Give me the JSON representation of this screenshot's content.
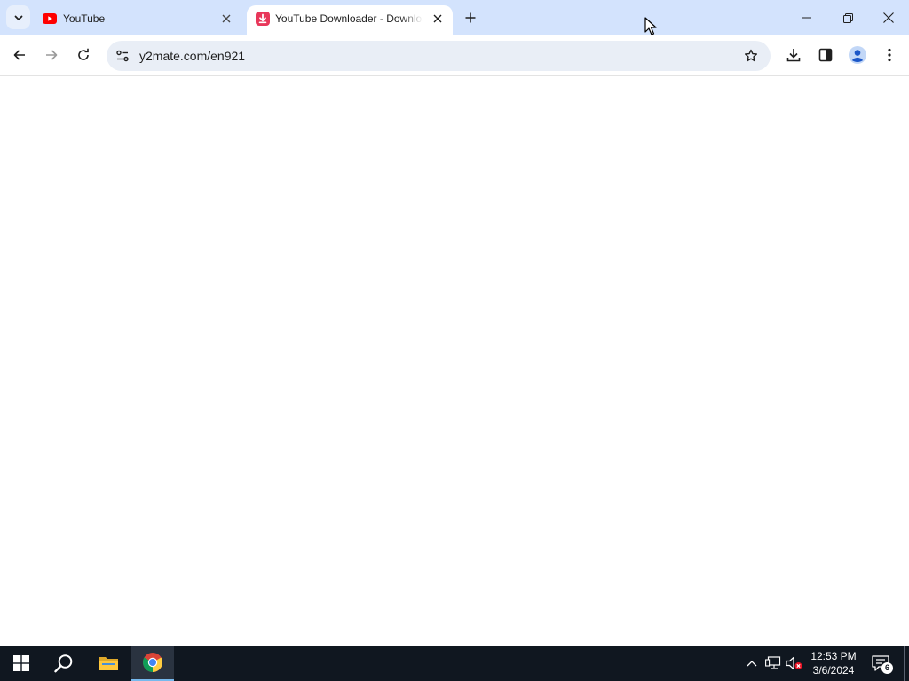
{
  "browser": {
    "tabs": [
      {
        "title": "YouTube",
        "favicon": "youtube-icon",
        "active": false
      },
      {
        "title": "YouTube Downloader - Download",
        "favicon": "downloader-icon",
        "active": true
      }
    ],
    "address_bar": {
      "url": "y2mate.com/en921"
    },
    "colors": {
      "tabstrip": "#d3e3fd",
      "omnibox": "#e9eef6",
      "youtube_red": "#ff0000",
      "downloader_red": "#e8375a"
    }
  },
  "taskbar": {
    "pinned": [
      "start-icon",
      "search-icon",
      "file-explorer-icon",
      "chrome-icon"
    ],
    "tray": [
      "chevron-up-icon",
      "network-icon",
      "volume-muted-icon"
    ],
    "clock": {
      "time": "12:53 PM",
      "date": "3/6/2024"
    },
    "notifications": {
      "count": "6"
    }
  }
}
